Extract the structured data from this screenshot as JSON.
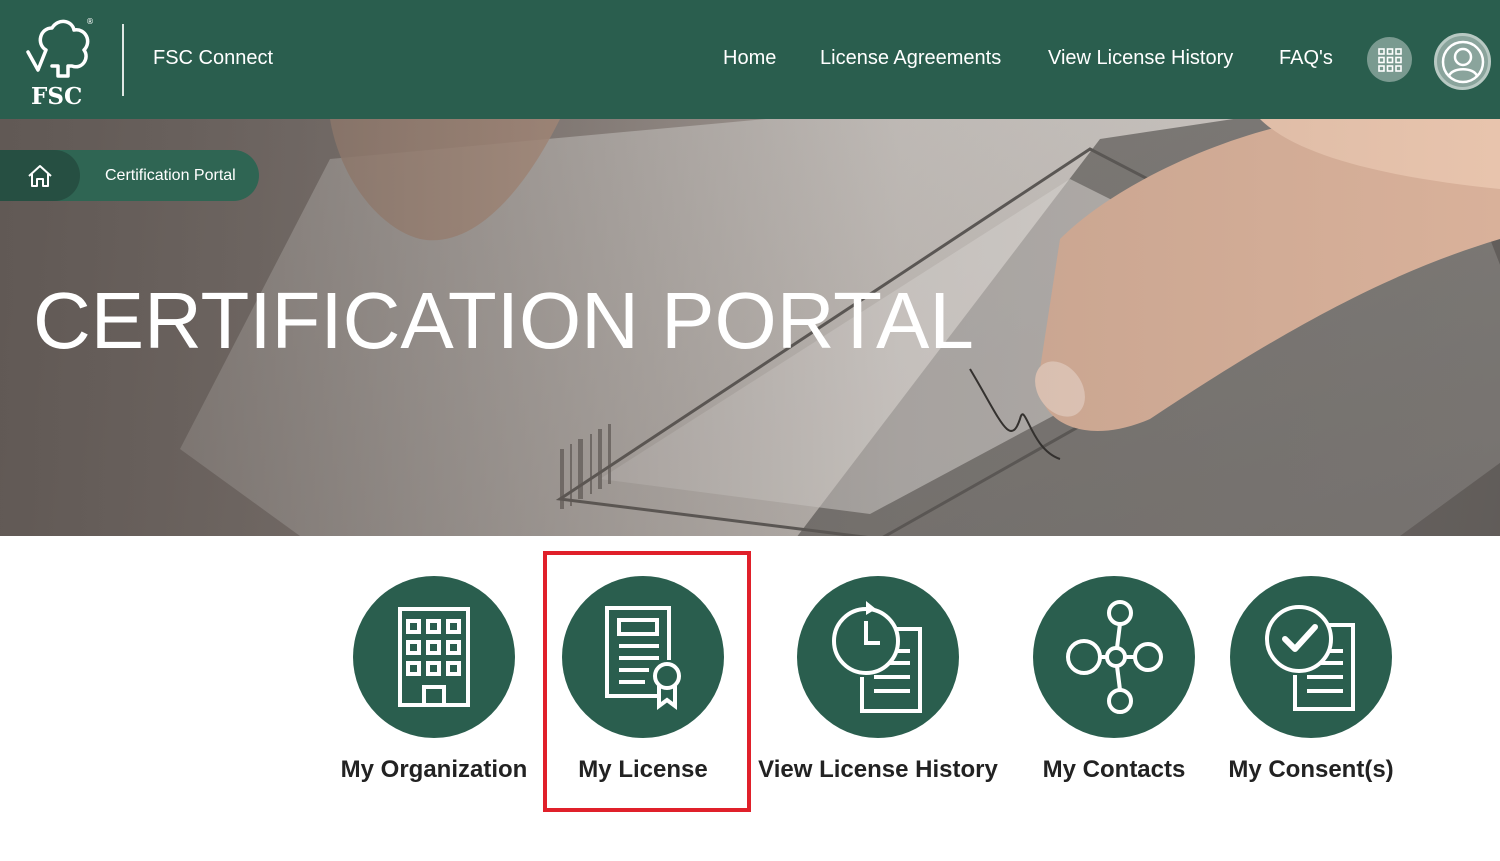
{
  "header": {
    "logo_text": "FSC",
    "app_title": "FSC Connect",
    "nav": {
      "home": "Home",
      "license_agreements": "License Agreements",
      "view_license_history": "View License History",
      "faqs": "FAQ's"
    }
  },
  "breadcrumb": {
    "current": "Certification Portal"
  },
  "hero": {
    "title": "CERTIFICATION PORTAL"
  },
  "tiles": [
    {
      "label": "My Organization",
      "icon": "building-icon"
    },
    {
      "label": "My License",
      "icon": "license-certificate-icon"
    },
    {
      "label": "View License History",
      "icon": "clock-document-icon"
    },
    {
      "label": "My Contacts",
      "icon": "network-nodes-icon"
    },
    {
      "label": "My Consent(s)",
      "icon": "checkmark-document-icon"
    }
  ],
  "colors": {
    "brand_green": "#2a5e4e",
    "highlight_red": "#e0202a"
  }
}
